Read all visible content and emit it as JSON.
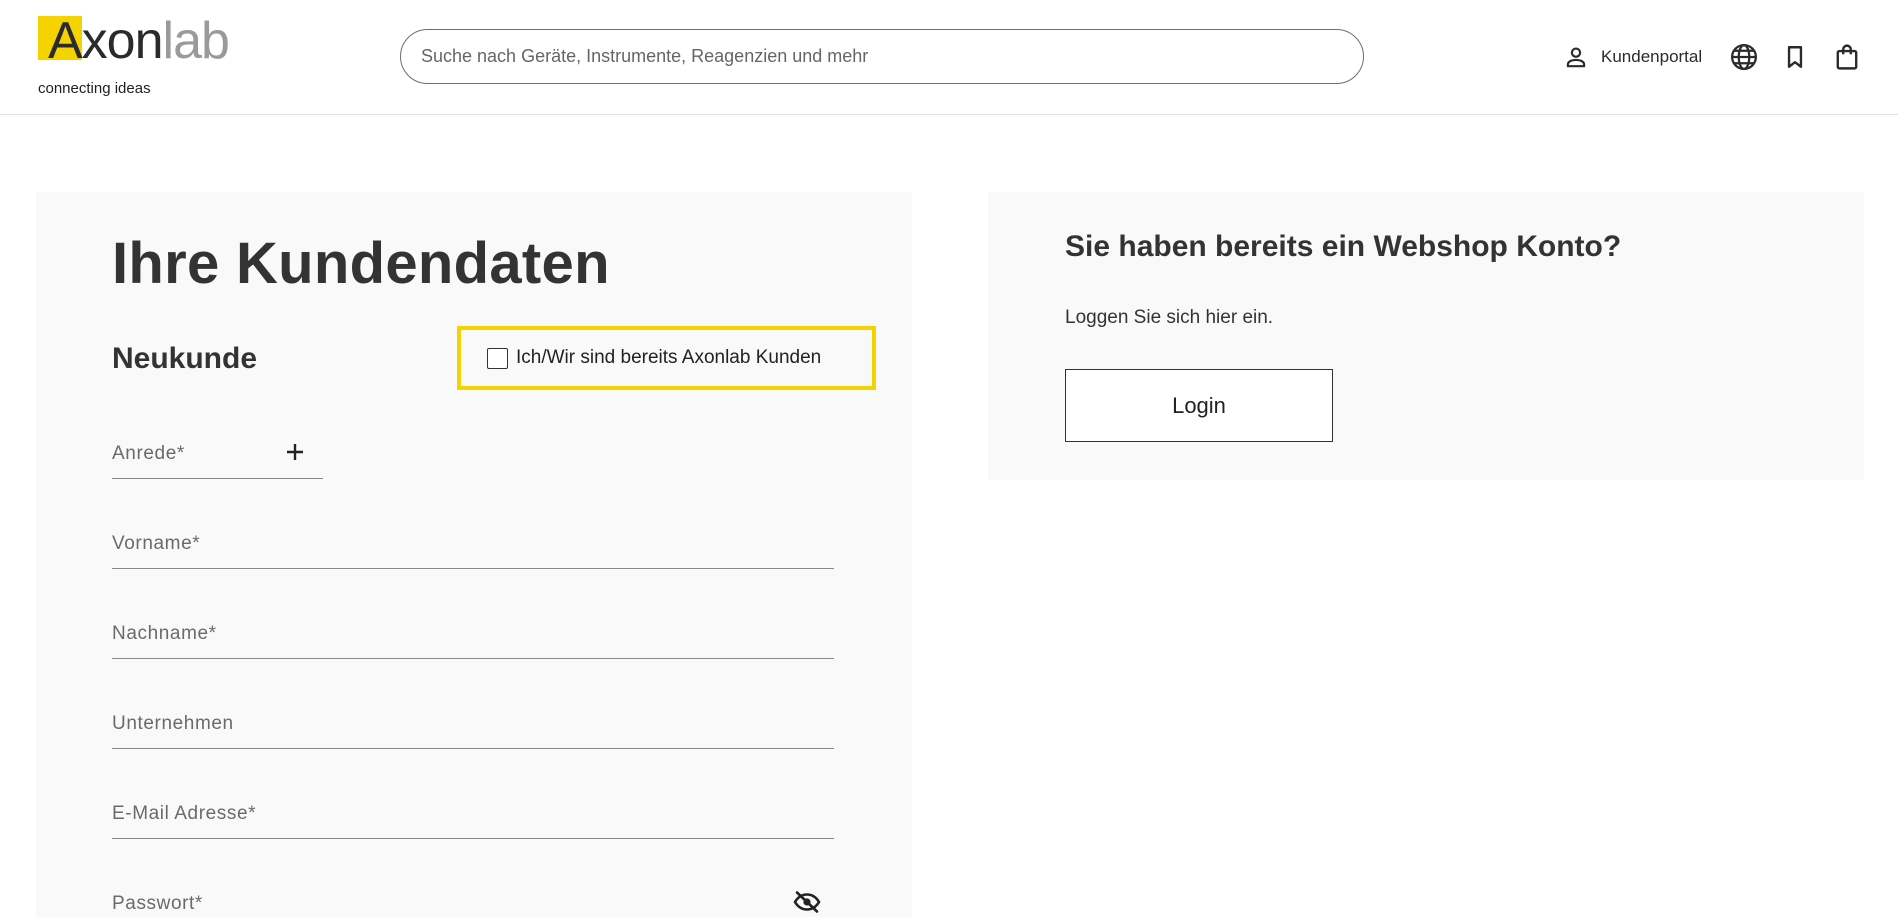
{
  "brand": {
    "logo_main": "Axon",
    "logo_accent": "lab",
    "tagline": "connecting ideas",
    "accent_color": "#f5d300"
  },
  "header": {
    "search_placeholder": "Suche nach Geräte, Instrumente, Reagenzien und mehr",
    "portal_label": "Kundenportal",
    "icons": [
      "user-icon",
      "globe-icon",
      "bookmark-icon",
      "shopping-bag-icon"
    ]
  },
  "registration": {
    "title": "Ihre Kundendaten",
    "subtitle": "Neukunde",
    "existing_customer_label": "Ich/Wir sind bereits Axonlab Kunden",
    "fields": {
      "salutation": "Anrede*",
      "first_name": "Vorname*",
      "last_name": "Nachname*",
      "company": "Unternehmen",
      "email": "E-Mail Adresse*",
      "password": "Passwort*"
    }
  },
  "login_panel": {
    "title": "Sie haben bereits ein Webshop Konto?",
    "text": "Loggen Sie sich hier ein.",
    "button_label": "Login"
  }
}
